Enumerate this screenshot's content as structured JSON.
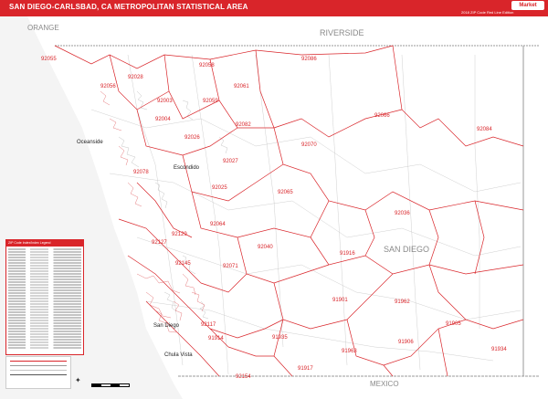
{
  "title": "SAN DIEGO-CARLSBAD, CA METROPOLITAN STATISTICAL AREA",
  "edition": "2018 ZIP Code Red Line Edition",
  "logo_text": "Market Maps",
  "legend_title": "ZIP Code Index/Index Legend",
  "region_labels": {
    "orange": "ORANGE",
    "riverside": "RIVERSIDE",
    "san_diego": "SAN DIEGO",
    "mexico": "MEXICO"
  },
  "cities": {
    "oceanside": "Oceanside",
    "escondido": "Escondido",
    "san_diego": "San Diego",
    "chula_vista": "Chula Vista"
  },
  "zip_labels": [
    "92055",
    "92086",
    "92028",
    "92058",
    "92061",
    "92056",
    "92003",
    "92004",
    "92059",
    "92066",
    "92084",
    "92082",
    "92026",
    "92070",
    "92078",
    "92027",
    "92025",
    "92065",
    "92036",
    "92064",
    "92040",
    "91916",
    "91901",
    "91962",
    "91905",
    "91906",
    "91934",
    "91935",
    "91963",
    "91917",
    "91914",
    "92154",
    "92127",
    "92129",
    "92145",
    "92071",
    "92117"
  ],
  "colors": {
    "brand": "#d9252a",
    "boundary": "#d9252a",
    "roads": "#b8b8b8",
    "county_line": "#9a9a9a",
    "water": "#ffffff"
  },
  "icons": [
    "compass-icon",
    "scale-bar-icon"
  ]
}
